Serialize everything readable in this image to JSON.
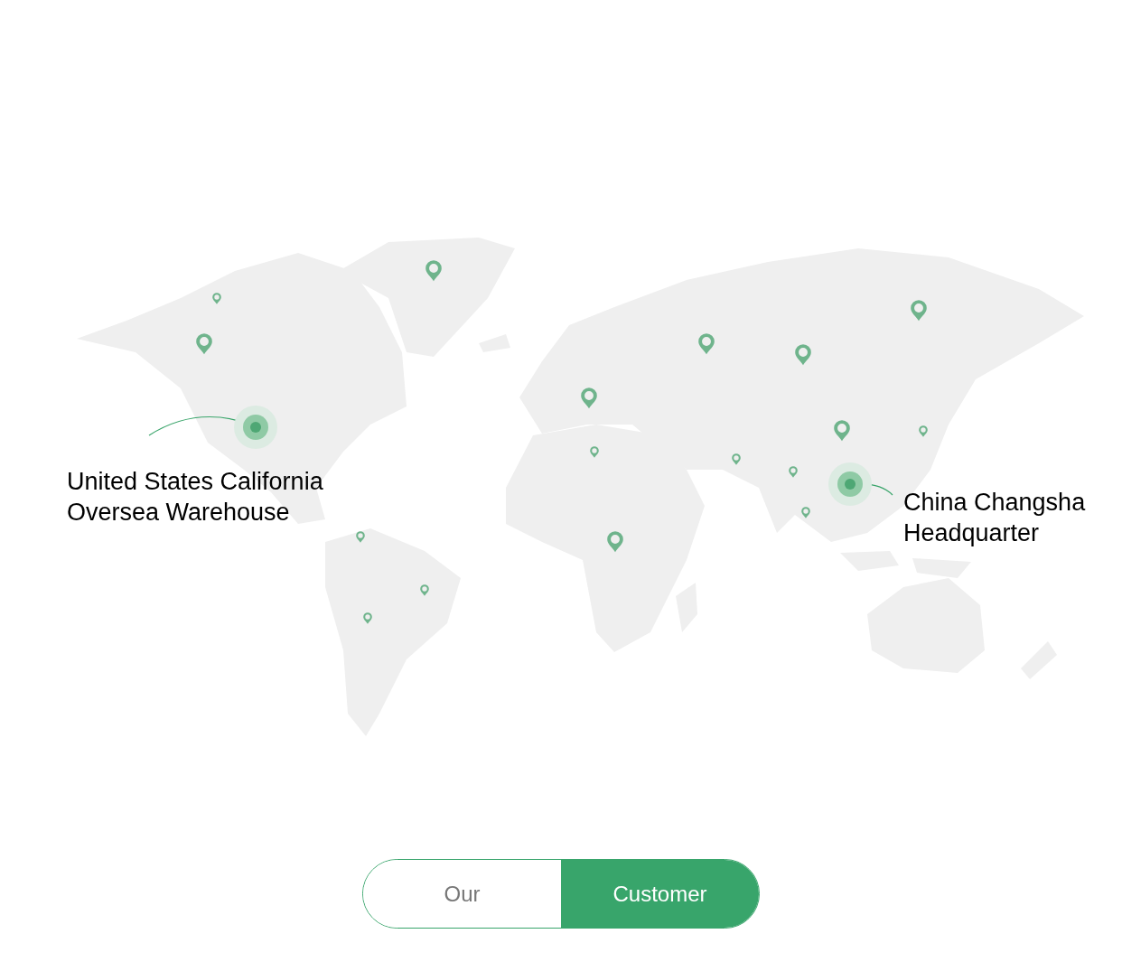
{
  "locations": [
    {
      "kind": "warehouse",
      "lines": [
        "United States California",
        "Oversea Warehouse"
      ]
    },
    {
      "kind": "headquarter",
      "lines": [
        "China Changsha",
        "Headquarter"
      ]
    }
  ],
  "tabs": [
    {
      "label": "Our",
      "selected": false
    },
    {
      "label": "Customer",
      "selected": true
    }
  ]
}
